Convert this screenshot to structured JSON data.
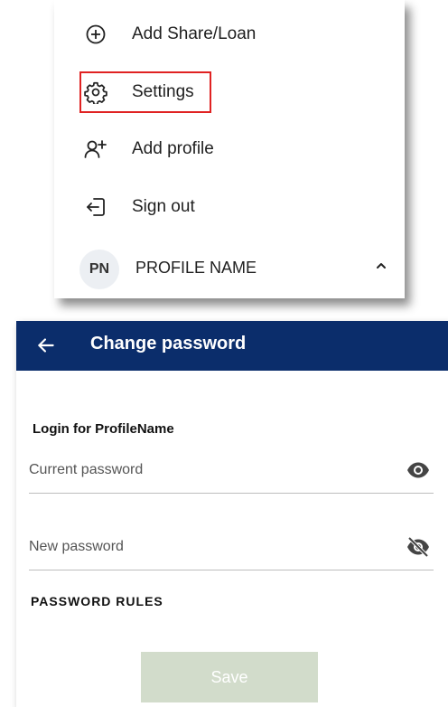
{
  "menu": {
    "items": [
      {
        "id": "add-share-loan",
        "label": "Add Share/Loan",
        "icon": "plus-circle-icon"
      },
      {
        "id": "settings",
        "label": "Settings",
        "icon": "gear-icon"
      },
      {
        "id": "add-profile",
        "label": "Add profile",
        "icon": "add-user-icon"
      },
      {
        "id": "sign-out",
        "label": "Sign out",
        "icon": "sign-out-icon"
      }
    ],
    "profile": {
      "initials": "PN",
      "name": "PROFILE NAME",
      "toggle_icon": "chevron-up-icon"
    },
    "highlight_color": "#e02222"
  },
  "screen": {
    "title": "Change password",
    "back_icon": "arrow-left-icon",
    "appbar_color": "#0b2d6b",
    "login_for": "Login for ProfileName",
    "current_password": {
      "placeholder": "Current password",
      "icon": "eye-icon"
    },
    "new_password": {
      "placeholder": "New password",
      "icon": "eye-off-icon"
    },
    "rules_heading": "PASSWORD RULES",
    "save_label": "Save",
    "save_color": "#d2dccb"
  }
}
